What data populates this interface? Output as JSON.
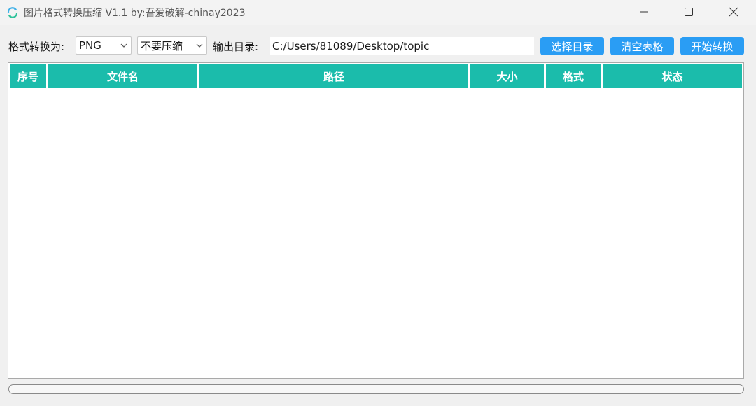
{
  "window": {
    "title": "图片格式转换压缩 V1.1 by:吾爱破解-chinay2023",
    "app_icon": "refresh-icon",
    "controls": [
      "minimize-icon",
      "maximize-icon",
      "close-icon"
    ]
  },
  "toolbar": {
    "format_label": "格式转换为:",
    "format_value": "PNG",
    "compress_value": "不要压缩",
    "output_label": "输出目录:",
    "output_path": "C:/Users/81089/Desktop/topic",
    "choose_dir_label": "选择目录",
    "clear_table_label": "清空表格",
    "start_label": "开始转换"
  },
  "table": {
    "columns": [
      "序号",
      "文件名",
      "路径",
      "大小",
      "格式",
      "状态"
    ],
    "rows": []
  },
  "progress": {
    "value": 0
  },
  "colors": {
    "header_bg": "#1bbcab",
    "button_bg": "#2a9df4"
  }
}
